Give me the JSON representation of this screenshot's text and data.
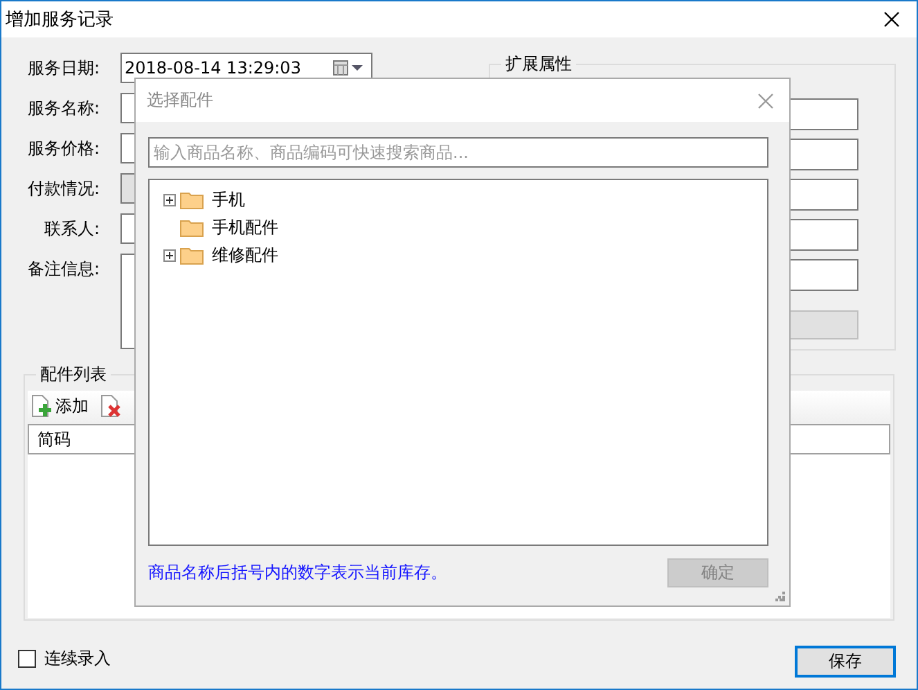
{
  "window": {
    "title": "增加服务记录"
  },
  "form": {
    "fields": [
      {
        "label": "服务日期:",
        "kind": "datetime",
        "value": "2018-08-14 13:29:03"
      },
      {
        "label": "服务名称:",
        "kind": "text"
      },
      {
        "label": "服务价格:",
        "kind": "text"
      },
      {
        "label": "付款情况:",
        "kind": "select"
      },
      {
        "label": "联系人:",
        "kind": "text"
      },
      {
        "label": "备注信息:",
        "kind": "textarea"
      }
    ]
  },
  "extended": {
    "title": "扩展属性",
    "inputs": [
      {
        "kind": "field"
      },
      {
        "kind": "field"
      },
      {
        "kind": "field"
      },
      {
        "kind": "field"
      },
      {
        "kind": "field"
      },
      {
        "kind": "button",
        "disabled": true
      }
    ]
  },
  "parts": {
    "title": "配件列表",
    "toolbar": [
      {
        "kind": "add",
        "label": "添加"
      },
      {
        "kind": "delete"
      }
    ],
    "columns": [
      "简码"
    ]
  },
  "continuous_entry": {
    "label": "连续录入",
    "checked": false
  },
  "save_button": {
    "label": "保存"
  },
  "dialog": {
    "title": "选择配件",
    "search": {
      "placeholder": "输入商品名称、商品编码可快速搜索商品..."
    },
    "tree": [
      {
        "label": "手机",
        "expandable": true
      },
      {
        "label": "手机配件",
        "expandable": false
      },
      {
        "label": "维修配件",
        "expandable": true
      }
    ],
    "hint": "商品名称后括号内的数字表示当前库存。",
    "ok": {
      "label": "确定",
      "disabled": true
    }
  }
}
